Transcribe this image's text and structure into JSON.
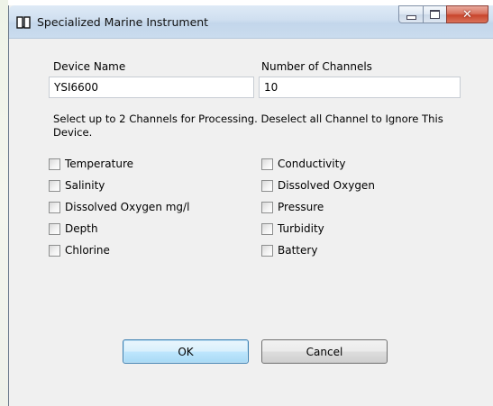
{
  "window": {
    "title": "Specialized Marine Instrument",
    "caption_buttons": {
      "minimize": "minimize",
      "maximize": "maximize",
      "close": "close"
    }
  },
  "form": {
    "device_name_label": "Device Name",
    "device_name_value": "YSI6600",
    "channels_label": "Number of Channels",
    "channels_value": "10",
    "instruction_line1": "Select up to 2 Channels for Processing.  Deselect all Channel to Ignore This",
    "instruction_line2": "Device."
  },
  "channels_left": [
    {
      "label": "Temperature",
      "checked": false
    },
    {
      "label": "Salinity",
      "checked": false
    },
    {
      "label": "Dissolved Oxygen mg/l",
      "checked": false
    },
    {
      "label": "Depth",
      "checked": false
    },
    {
      "label": "Chlorine",
      "checked": false
    }
  ],
  "channels_right": [
    {
      "label": "Conductivity",
      "checked": false
    },
    {
      "label": "Dissolved Oxygen",
      "checked": false
    },
    {
      "label": "Pressure",
      "checked": false
    },
    {
      "label": "Turbidity",
      "checked": false
    },
    {
      "label": "Battery",
      "checked": false
    }
  ],
  "buttons": {
    "ok": "OK",
    "cancel": "Cancel"
  }
}
